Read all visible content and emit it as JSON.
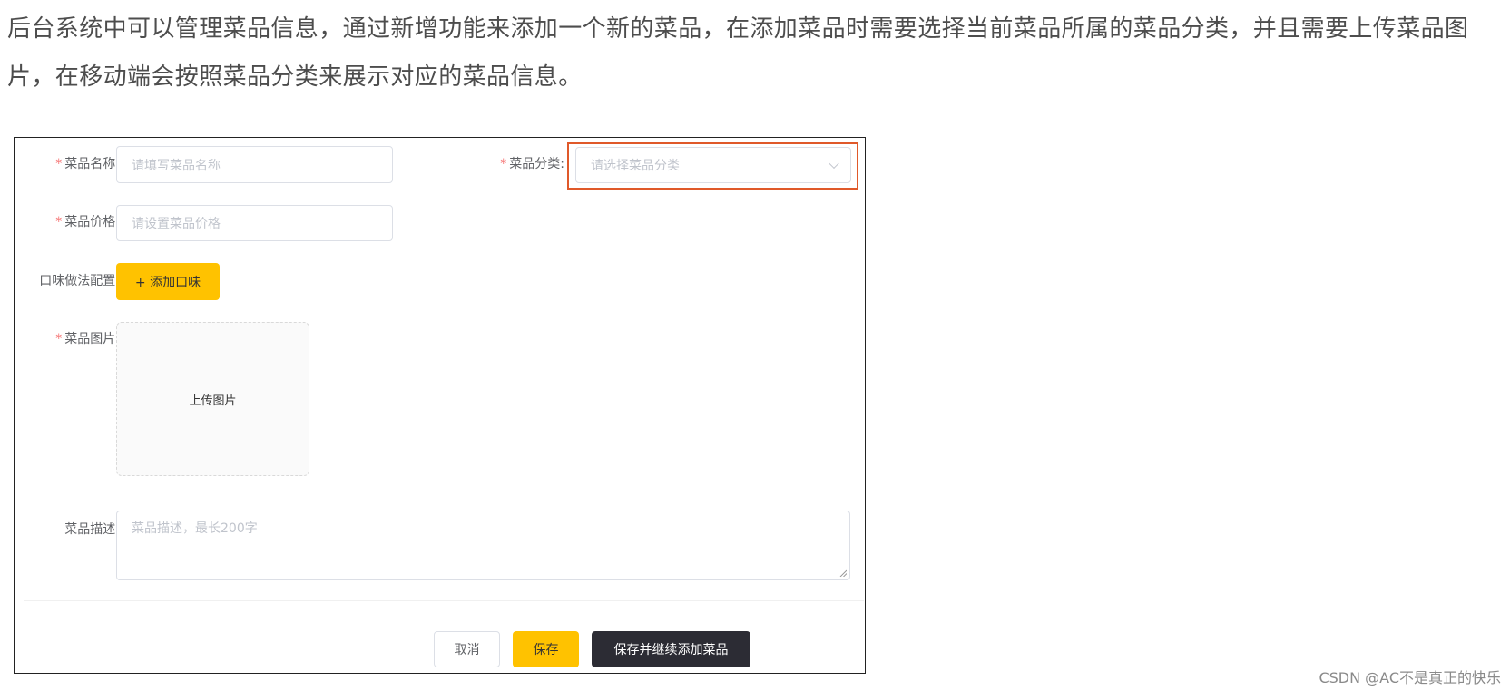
{
  "intro_text": "后台系统中可以管理菜品信息，通过新增功能来添加一个新的菜品，在添加菜品时需要选择当前菜品所属的菜品分类，并且需要上传菜品图片，在移动端会按照菜品分类来展示对应的菜品信息。",
  "form": {
    "required_mark": "*",
    "name_label": "菜品名称:",
    "name_placeholder": "请填写菜品名称",
    "category_label": "菜品分类:",
    "category_placeholder": "请选择菜品分类",
    "price_label": "菜品价格:",
    "price_placeholder": "请设置菜品价格",
    "flavor_label": "口味做法配置:",
    "add_flavor_button": "+ 添加口味",
    "image_label": "菜品图片:",
    "upload_text": "上传图片",
    "desc_label": "菜品描述:",
    "desc_placeholder": "菜品描述，最长200字"
  },
  "footer": {
    "cancel_label": "取消",
    "save_label": "保存",
    "save_continue_label": "保存并继续添加菜品"
  },
  "watermark": "CSDN @AC不是真正的快乐",
  "colors": {
    "accent_yellow": "#ffc200",
    "dark_button": "#2c2c34",
    "highlight_red": "#e0592a",
    "required_red": "#f56c6c"
  }
}
